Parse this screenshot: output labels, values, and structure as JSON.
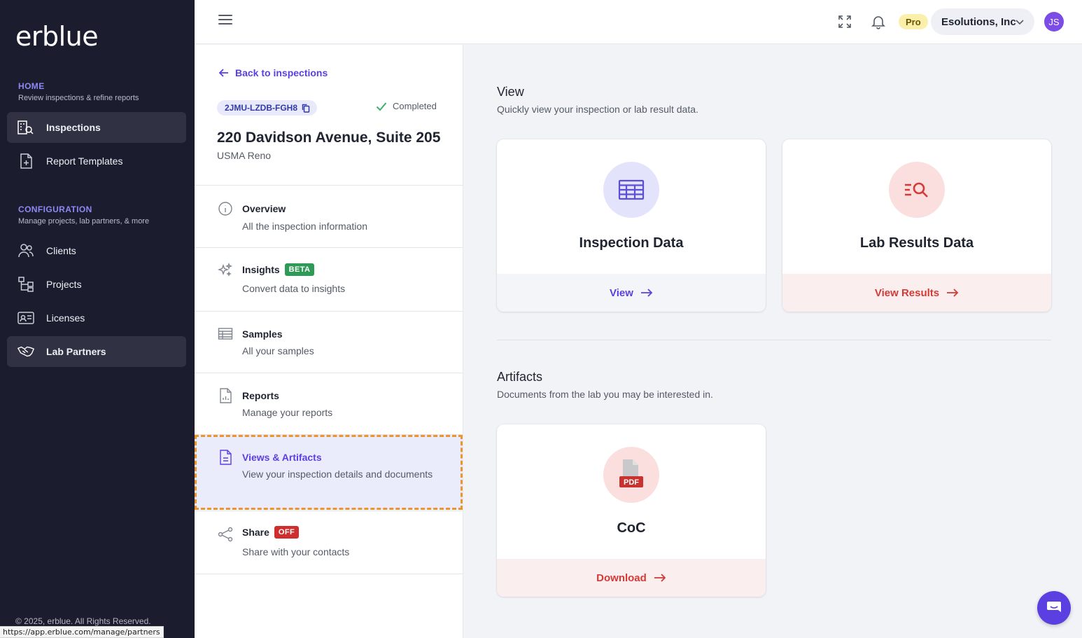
{
  "brand": {
    "logo_text": "erblue"
  },
  "sidebar": {
    "home_heading": "HOME",
    "home_sub": "Review inspections & refine reports",
    "config_heading": "CONFIGURATION",
    "config_sub": "Manage projects, lab partners, & more",
    "items": [
      {
        "label": "Inspections",
        "icon": "building-search-icon",
        "active": true
      },
      {
        "label": "Report Templates",
        "icon": "file-plus-icon",
        "active": false
      },
      {
        "label": "Clients",
        "icon": "users-icon",
        "active": false
      },
      {
        "label": "Projects",
        "icon": "hierarchy-icon",
        "active": false
      },
      {
        "label": "Licenses",
        "icon": "id-card-icon",
        "active": false
      },
      {
        "label": "Lab Partners",
        "icon": "handshake-icon",
        "active": true
      }
    ],
    "copyright": "© 2025, erblue. All Rights Reserved."
  },
  "status_bar_url": "https://app.erblue.com/manage/partners",
  "topbar": {
    "plan_badge": "Pro",
    "org_name": "Esolutions, Inc",
    "avatar_initials": "JS",
    "icons": [
      "menu-icon",
      "fullscreen-icon",
      "bell-icon",
      "chevron-down-icon"
    ]
  },
  "inspection": {
    "back_label": "Back to inspections",
    "id": "2JMU-LZDB-FGH8",
    "status": "Completed",
    "address": "220 Davidson Avenue, Suite 205",
    "location": "USMA Reno",
    "menu": [
      {
        "title": "Overview",
        "subtitle": "All the inspection information",
        "icon": "info-icon"
      },
      {
        "title": "Insights",
        "tag": "BETA",
        "subtitle": "Convert data to insights",
        "icon": "sparkles-icon"
      },
      {
        "title": "Samples",
        "subtitle": "All your samples",
        "icon": "table-icon"
      },
      {
        "title": "Reports",
        "subtitle": "Manage your reports",
        "icon": "report-file-icon"
      },
      {
        "title": "Views & Artifacts",
        "subtitle": "View your inspection details and documents",
        "icon": "document-icon",
        "active": true
      },
      {
        "title": "Share",
        "tag": "OFF",
        "subtitle": "Share with your contacts",
        "icon": "share-icon"
      }
    ]
  },
  "view_section": {
    "title": "View",
    "subtitle": "Quickly view your inspection or lab result data.",
    "cards": [
      {
        "title": "Inspection Data",
        "action": "View",
        "icon": "table-icon"
      },
      {
        "title": "Lab Results Data",
        "action": "View Results",
        "icon": "list-search-icon"
      }
    ]
  },
  "artifacts_section": {
    "title": "Artifacts",
    "subtitle": "Documents from the lab you may be interested in.",
    "cards": [
      {
        "title": "CoC",
        "action": "Download",
        "icon": "pdf-file-icon",
        "icon_label": "PDF"
      }
    ]
  },
  "colors": {
    "sidebar_bg": "#1b1d2f",
    "accent": "#5b3fe0",
    "danger": "#d43a36",
    "highlight_border": "#ec942e"
  }
}
